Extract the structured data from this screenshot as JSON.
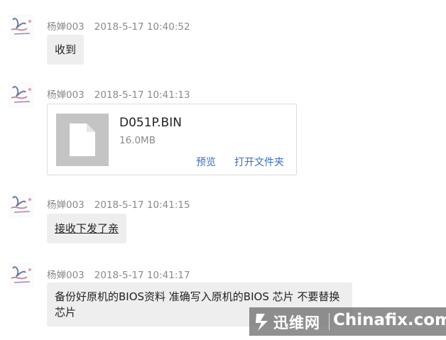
{
  "messages": [
    {
      "sender": "杨婵003",
      "time": "2018-5-17 10:40:52",
      "text": "收到"
    },
    {
      "sender": "杨婵003",
      "time": "2018-5-17 10:41:13",
      "file": {
        "name": "D051P.BIN",
        "size": "16.0MB",
        "action_preview": "预览",
        "action_open_folder": "打开文件夹"
      }
    },
    {
      "sender": "杨婵003",
      "time": "2018-5-17 10:41:15",
      "text": "接收下发了亲"
    },
    {
      "sender": "杨婵003",
      "time": "2018-5-17 10:41:17",
      "text": "备份好原机的BIOS资料 准确写入原机的BIOS 芯片  不要替换芯片"
    }
  ],
  "watermark": {
    "cn": "迅维网",
    "en": "Chinafix.com"
  },
  "colors": {
    "bubble": "#eeeeee",
    "meta": "#8a8a8a",
    "link": "#3a6fc2",
    "file_icon_bg": "#c4c4c4"
  }
}
